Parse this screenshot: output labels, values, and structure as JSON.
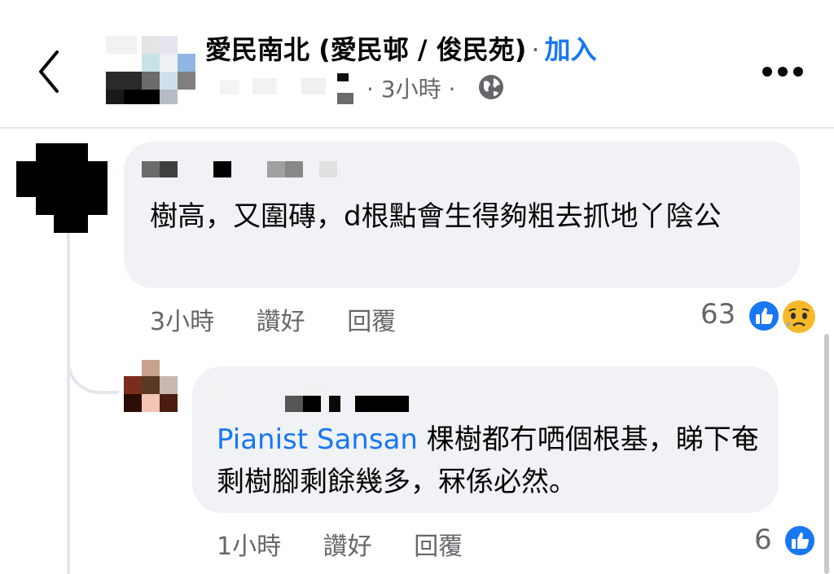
{
  "header": {
    "back_icon": "chevron-left-icon",
    "group_name": "愛民南北 (愛民邨 / 俊民苑)",
    "separator": "·",
    "join_label": "加入",
    "post_time": "· 3小時 ·",
    "privacy_icon": "globe-icon",
    "more_icon": "more-horizontal-icon"
  },
  "comments": [
    {
      "text": "樹高，又圍磚，d根點會生得夠粗去抓地丫陰公",
      "time": "3小時",
      "like_label": "讚好",
      "reply_label": "回覆",
      "reaction_count": "63",
      "reactions": [
        "like-icon",
        "sad-icon"
      ]
    },
    {
      "mention": "Pianist Sansan",
      "text": " 棵樹都冇哂個根基，睇下奄剩樹腳剩餘幾多，冧係必然。",
      "time": "1小時",
      "like_label": "讚好",
      "reply_label": "回覆",
      "reaction_count": "6",
      "reactions": [
        "like-icon"
      ]
    }
  ],
  "colors": {
    "accent": "#1877f2",
    "bubble": "#f0f2f5",
    "secondary_text": "#65676b",
    "like": "#1877f2",
    "sad": "#f7b928"
  }
}
